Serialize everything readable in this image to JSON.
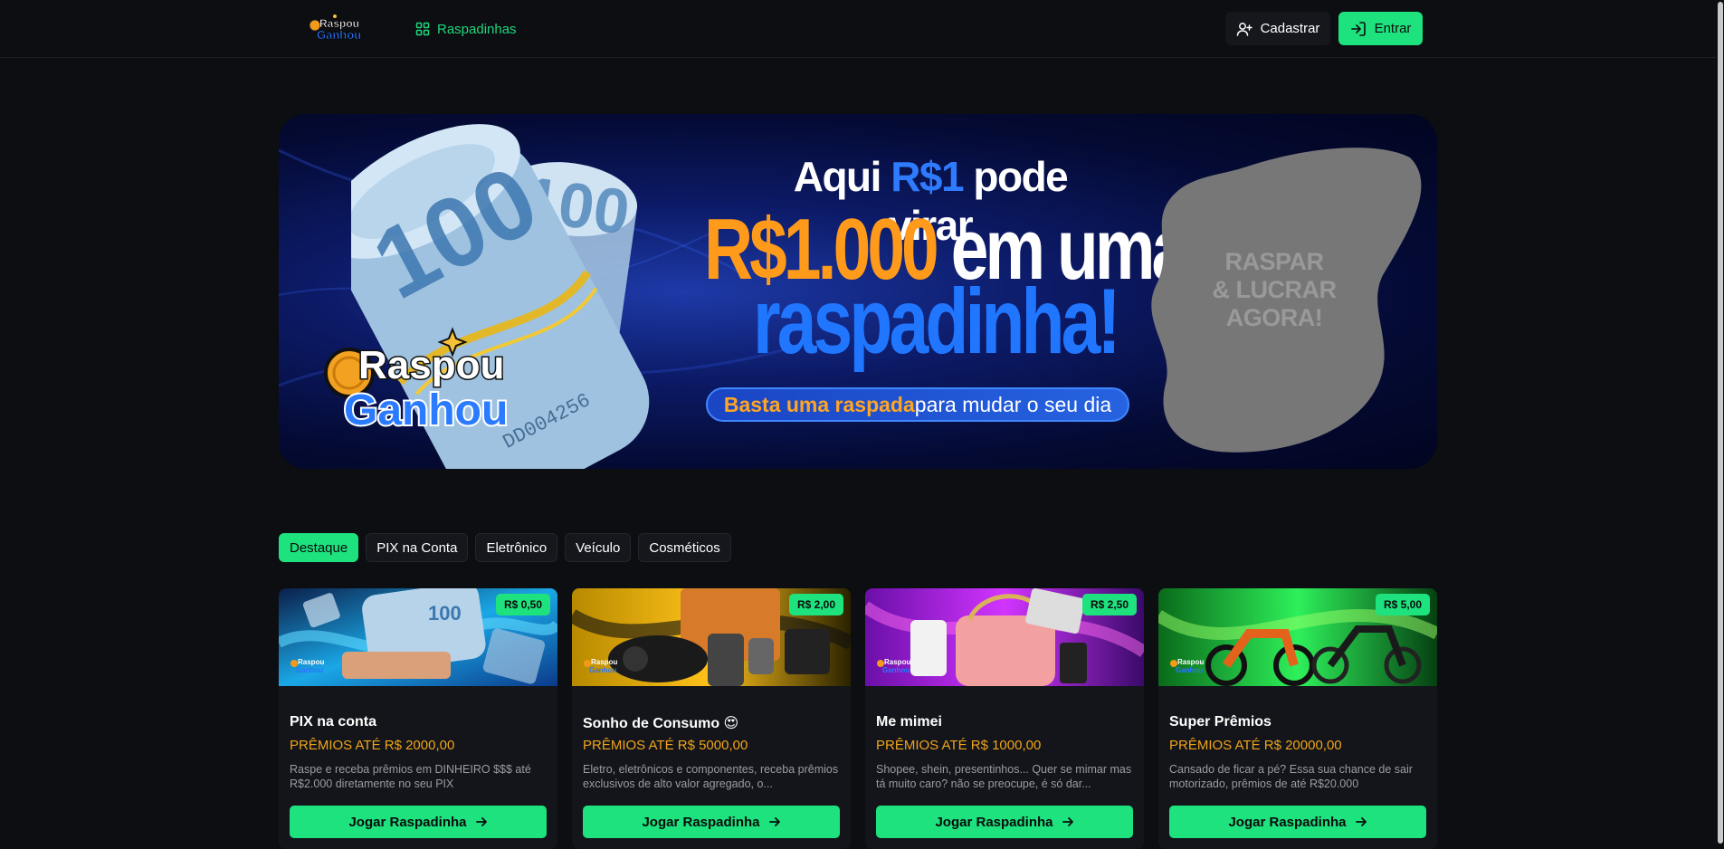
{
  "header": {
    "logo_alt": "Raspou Ganhou",
    "logo_line1": "Raspou",
    "logo_line2": "Ganhou",
    "nav_label": "Raspadinhas",
    "register_label": "Cadastrar",
    "login_label": "Entrar"
  },
  "banner": {
    "line1_a": "Aqui ",
    "line1_b": "R$1",
    "line1_c": " pode virar",
    "line2_a": "R$1.000",
    "line2_b": " em uma",
    "line3": "raspadinha!",
    "pill_a": "Basta uma raspada",
    "pill_b": " para mudar o seu dia",
    "scratch_l1": "RASPAR",
    "scratch_l2": "& LUCRAR",
    "scratch_l3": "AGORA!",
    "logo_line1": "Raspou",
    "logo_line2": "Ganhou"
  },
  "tabs": [
    "Destaque",
    "PIX na Conta",
    "Eletrônico",
    "Veículo",
    "Cosméticos"
  ],
  "cards": [
    {
      "price": "R$ 0,50",
      "title": "PIX na conta",
      "prize": "PRÊMIOS ATÉ R$ 2000,00",
      "desc": "Raspe e receba prêmios em DINHEIRO $$$ até R$2.000 diretamente no seu PIX",
      "button": "Jogar Raspadinha"
    },
    {
      "price": "R$ 2,00",
      "title": "Sonho de Consumo 😍",
      "prize": "PRÊMIOS ATÉ R$ 5000,00",
      "desc": "Eletro, eletrônicos e componentes, receba prêmios exclusivos de alto valor agregado, o...",
      "button": "Jogar Raspadinha"
    },
    {
      "price": "R$ 2,50",
      "title": "Me mimei",
      "prize": "PRÊMIOS ATÉ R$ 1000,00",
      "desc": "Shopee, shein, presentinhos... Quer se mimar mas tá muito caro? não se preocupe, é só dar...",
      "button": "Jogar Raspadinha"
    },
    {
      "price": "R$ 5,00",
      "title": "Super Prêmios",
      "prize": "PRÊMIOS ATÉ R$ 20000,00",
      "desc": "Cansado de ficar a pé? Essa sua chance de sair motorizado, prêmios de até R$20.000",
      "button": "Jogar Raspadinha"
    }
  ],
  "colors": {
    "accent": "#1de27e",
    "prize": "#f0a41b",
    "background": "#0d0e12"
  }
}
